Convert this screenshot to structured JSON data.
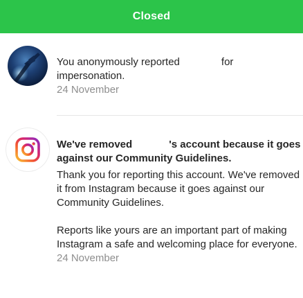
{
  "status_bar": {
    "label": "Closed",
    "color": "#2cc44a"
  },
  "notifications": [
    {
      "avatar": "user-avatar",
      "text_before": "You anonymously reported",
      "text_after": "for",
      "text_line2": "impersonation.",
      "date": "24 November"
    },
    {
      "avatar": "instagram-logo-icon",
      "title_before": "We've removed",
      "title_after": "'s account because it goes",
      "title_line2": "against our Community Guidelines.",
      "paragraph_1": "Thank you for reporting this account. We've removed it from Instagram because it goes against our Community Guidelines.",
      "paragraph_2": "Reports like yours are an important part of making Instagram a safe and welcoming place for everyone.",
      "date": "24 November"
    }
  ]
}
